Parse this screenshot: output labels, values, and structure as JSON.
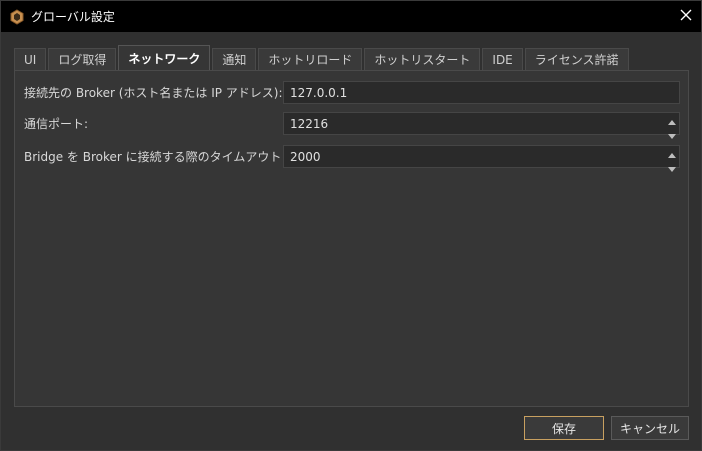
{
  "window": {
    "title": "グローバル設定",
    "icon": "app-logo-icon",
    "close_icon": "close-icon"
  },
  "tabs": [
    {
      "label": "UI",
      "active": false
    },
    {
      "label": "ログ取得",
      "active": false
    },
    {
      "label": "ネットワーク",
      "active": true
    },
    {
      "label": "通知",
      "active": false
    },
    {
      "label": "ホットリロード",
      "active": false
    },
    {
      "label": "ホットリスタート",
      "active": false
    },
    {
      "label": "IDE",
      "active": false
    },
    {
      "label": "ライセンス許諾",
      "active": false
    }
  ],
  "network": {
    "host": {
      "label": "接続先の Broker (ホスト名または IP アドレス):",
      "value": "127.0.0.1"
    },
    "port": {
      "label": "通信ポート:",
      "value": "12216"
    },
    "timeout": {
      "label": "Bridge を Broker に接続する際のタイムアウト (ミリ秒):",
      "value": "2000"
    }
  },
  "buttons": {
    "save": "保存",
    "cancel": "キャンセル"
  },
  "colors": {
    "titlebar": "#000000",
    "window_bg": "#303030",
    "panel_bg": "#363636",
    "field_bg": "#2a2a2a",
    "save_border": "#c8a060"
  }
}
